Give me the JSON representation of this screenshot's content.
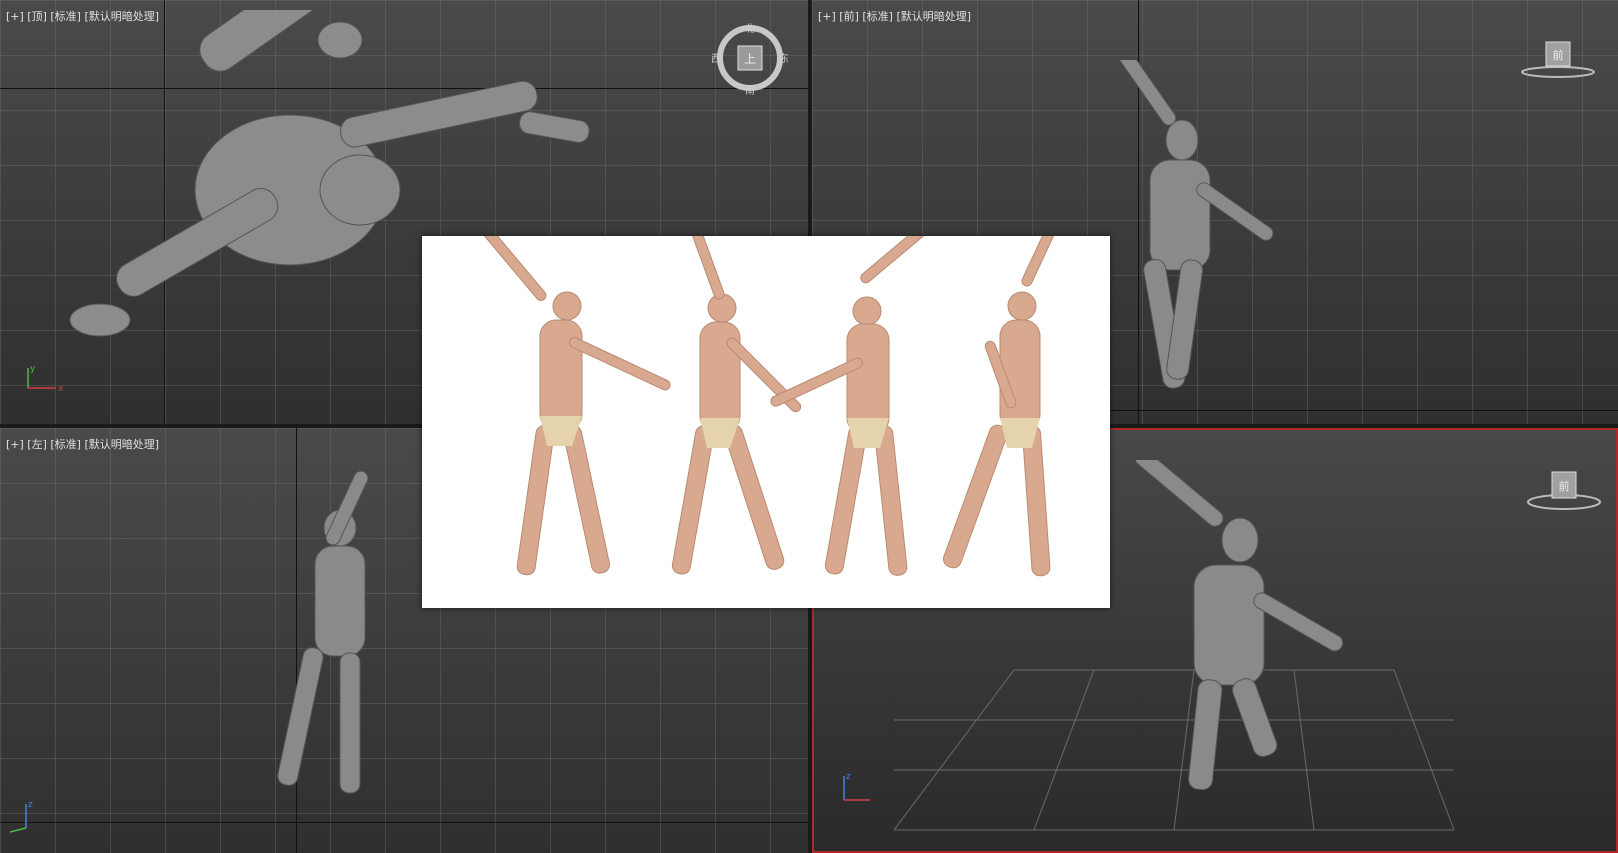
{
  "viewports": {
    "top": {
      "label": "[+] [顶] [标准] [默认明暗处理]",
      "compass": {
        "n": "北",
        "s": "南",
        "e": "东",
        "w": "西",
        "center": "上"
      }
    },
    "front": {
      "label": "[+] [前] [标准] [默认明暗处理]",
      "cube_label": "前"
    },
    "left": {
      "label": "[+] [左] [标准] [默认明暗处理]"
    },
    "perspective": {
      "label": "",
      "cube_label": "前"
    }
  },
  "axis": {
    "x": "x",
    "y": "y",
    "z": "z"
  },
  "colors": {
    "border_active": "#b02a2a",
    "mannequin": "#8c8c8c",
    "skin": "#d9a98f"
  }
}
